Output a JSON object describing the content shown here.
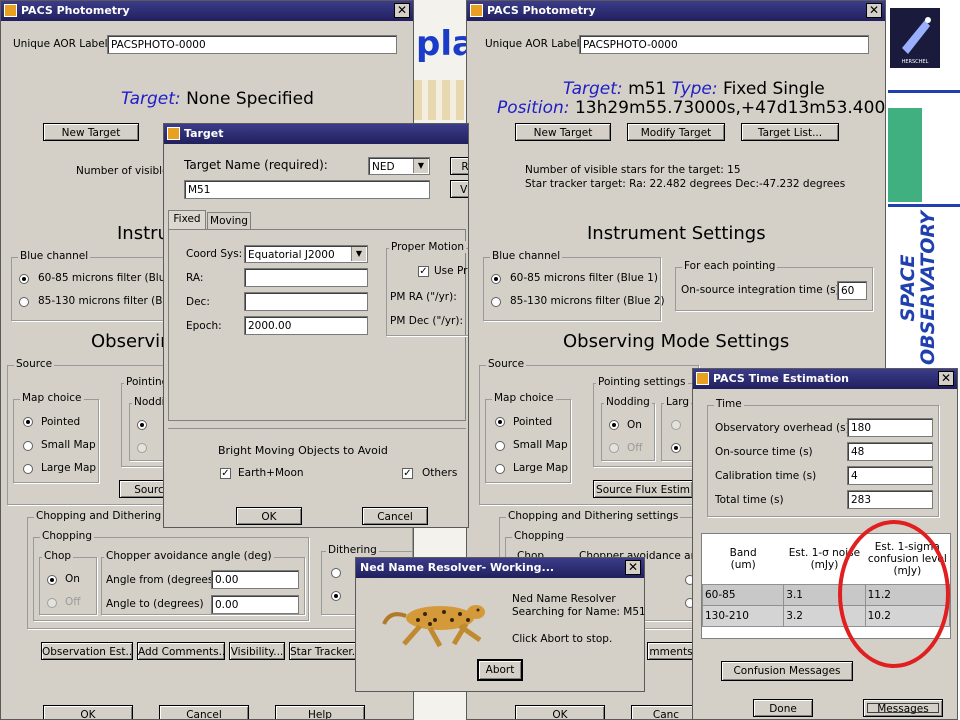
{
  "background": {
    "banner_fragment": "pla",
    "herschel_badge_text": "HERSCHEL",
    "space_observatory": "SPACE OBSERVATORY"
  },
  "left_window": {
    "title": "PACS Photometry",
    "aor_label": "Unique AOR Label:",
    "aor_value": "PACSPHOTO-0000",
    "target_prefix": "Target:",
    "target_value": "None Specified",
    "new_target": "New Target",
    "visible_stars": "Number of visible",
    "instrument_frag": "Instru",
    "blue_channel": "Blue channel",
    "filter1": "60-85 microns filter (Blue 1",
    "filter2": "85-130 microns filter (Blue",
    "observing_frag": "Observin",
    "source": "Source",
    "map_choice": "Map choice",
    "pointed": "Pointed",
    "small_map": "Small Map",
    "large_map": "Large Map",
    "pointing_frag": "Pointing",
    "nodding_frag": "Noddin",
    "source_btn_frag": "Sourc",
    "chop_dither": "Chopping and Dithering setti",
    "chopping": "Chopping",
    "chop": "Chop",
    "on": "On",
    "off": "Off",
    "chopper_avoid": "Chopper avoidance angle (deg)",
    "angle_from": "Angle from (degrees)",
    "angle_from_val": "0.00",
    "angle_to": "Angle to (degrees)",
    "angle_to_val": "0.00",
    "dithering": "Dithering",
    "btn_obs_est": "Observation Est...",
    "btn_add_comments": "Add Comments...",
    "btn_visibility": "Visibility...",
    "btn_star_tracker": "Star Tracker...",
    "ok": "OK",
    "cancel": "Cancel",
    "help": "Help"
  },
  "right_window": {
    "title": "PACS Photometry",
    "aor_label": "Unique AOR Label:",
    "aor_value": "PACSPHOTO-0000",
    "target_prefix": "Target:",
    "target_value": "m51",
    "type_prefix": "Type:",
    "type_value": "Fixed Single",
    "position_prefix": "Position:",
    "position_value": "13h29m55.73000s,+47d13m53.4000s",
    "new_target": "New Target",
    "modify_target": "Modify Target",
    "target_list": "Target List...",
    "stars_line": "Number of visible stars for the target: 15",
    "tracker_line": "Star tracker target: Ra: 22.482 degrees Dec:-47.232 degrees",
    "instrument_settings": "Instrument Settings",
    "blue_channel": "Blue channel",
    "filter1": "60-85 microns filter (Blue 1)",
    "filter2": "85-130 microns filter (Blue 2)",
    "each_pointing": "For each pointing",
    "onsource_label": "On-source integration time (s):",
    "onsource_val": "60",
    "observing_mode": "Observing Mode Settings",
    "source": "Source",
    "map_choice": "Map choice",
    "pointed": "Pointed",
    "small_map": "Small Map",
    "large_map": "Large Map",
    "pointing_settings": "Pointing settings",
    "nodding": "Nodding",
    "on": "On",
    "off": "Off",
    "large_frag": "Larg",
    "source_flux": "Source Flux Estim",
    "chop_dither": "Chopping and Dithering settings",
    "chopping": "Chopping",
    "chop_frag": "Chop",
    "chopper_frag": "Chopper avoidance ang",
    "ments_frag": "mments...",
    "ok": "OK",
    "cancel_frag": "Canc"
  },
  "target_dialog": {
    "title": "Target",
    "name_label": "Target Name (required):",
    "resolver": "NED",
    "name_value": "M51",
    "r_frag": "R",
    "v_frag": "Vi",
    "tab_fixed": "Fixed",
    "tab_moving": "Moving",
    "coord_label": "Coord Sys:",
    "coord_value": "Equatorial J2000",
    "ra_label": "RA:",
    "dec_label": "Dec:",
    "epoch_label": "Epoch:",
    "epoch_value": "2000.00",
    "proper_motion": "Proper Motion",
    "use_pm": "Use Pr",
    "pm_ra": "PM RA (\"/yr):",
    "pm_dec": "PM Dec (\"/yr):",
    "bright_objects": "Bright Moving Objects to Avoid",
    "earth_moon": "Earth+Moon",
    "others": "Others",
    "ok": "OK",
    "cancel": "Cancel"
  },
  "ned_dialog": {
    "title": "Ned Name Resolver- Working...",
    "line1": "Ned Name Resolver",
    "line2": "Searching for Name: M51",
    "line3": "Click Abort  to stop.",
    "abort": "Abort"
  },
  "time_window": {
    "title": "PACS Time Estimation",
    "time_group": "Time",
    "rows": [
      {
        "label": "Observatory overhead (s)",
        "value": "180"
      },
      {
        "label": "On-source time (s)",
        "value": "48"
      },
      {
        "label": "Calibration time (s)",
        "value": "4"
      },
      {
        "label": "Total time (s)",
        "value": "283"
      }
    ],
    "table_headers": [
      [
        "Band",
        "(um)"
      ],
      [
        "Est. 1-σ noise",
        "(mJy)"
      ],
      [
        "Est. 1-sigma",
        "confusion level",
        "(mJy)"
      ]
    ],
    "table_rows": [
      [
        "60-85",
        "3.1",
        "11.2"
      ],
      [
        "130-210",
        "3.2",
        "10.2"
      ]
    ],
    "confusion_messages": "Confusion Messages",
    "done": "Done",
    "messages": "Messages"
  },
  "colors": {
    "titlebar": "#20205e",
    "dialog_bg": "#d4d0c8",
    "highlight_circle": "#e02020",
    "accent_green": "#40b080",
    "accent_blue": "#2040b0"
  }
}
